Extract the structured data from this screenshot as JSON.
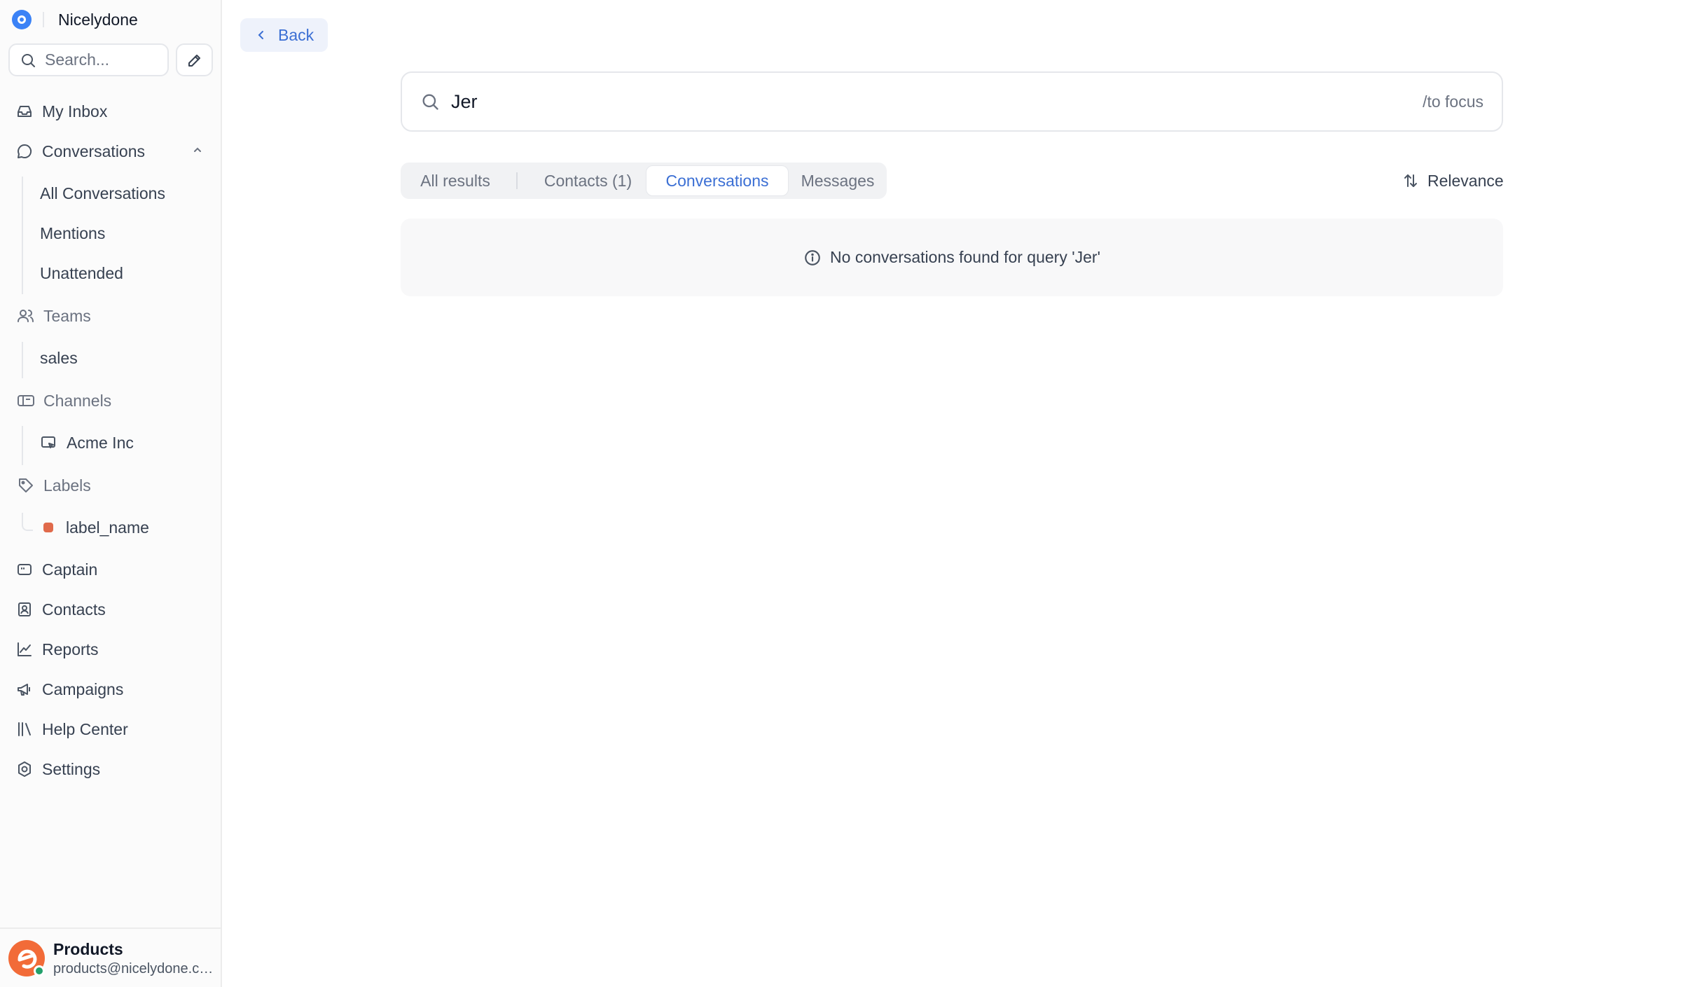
{
  "brand": {
    "name": "Nicelydone"
  },
  "sidebar": {
    "search_placeholder": "Search...",
    "nav": {
      "my_inbox": "My Inbox",
      "conversations": "Conversations",
      "conversations_sub": [
        "All Conversations",
        "Mentions",
        "Unattended"
      ],
      "teams": "Teams",
      "teams_sub": [
        "sales"
      ],
      "channels": "Channels",
      "channels_sub": [
        "Acme Inc"
      ],
      "labels": "Labels",
      "labels_sub": [
        {
          "name": "label_name",
          "color": "#e06a4b"
        }
      ],
      "captain": "Captain",
      "contacts": "Contacts",
      "reports": "Reports",
      "campaigns": "Campaigns",
      "help_center": "Help Center",
      "settings": "Settings"
    },
    "profile": {
      "name": "Products",
      "email": "products@nicelydone.club",
      "status": "online"
    }
  },
  "main": {
    "back_label": "Back",
    "search": {
      "value": "Jer",
      "hint": "/to focus"
    },
    "tabs": [
      {
        "label": "All results",
        "active": false
      },
      {
        "label": "Contacts (1)",
        "active": false
      },
      {
        "label": "Conversations",
        "active": true
      },
      {
        "label": "Messages",
        "active": false
      }
    ],
    "sort_label": "Relevance",
    "empty_message": "No conversations found for query 'Jer'"
  },
  "colors": {
    "accent": "#3b6fd4",
    "brand_logo": "#3b82f6",
    "avatar": "#f26b38",
    "online": "#22a06b"
  }
}
